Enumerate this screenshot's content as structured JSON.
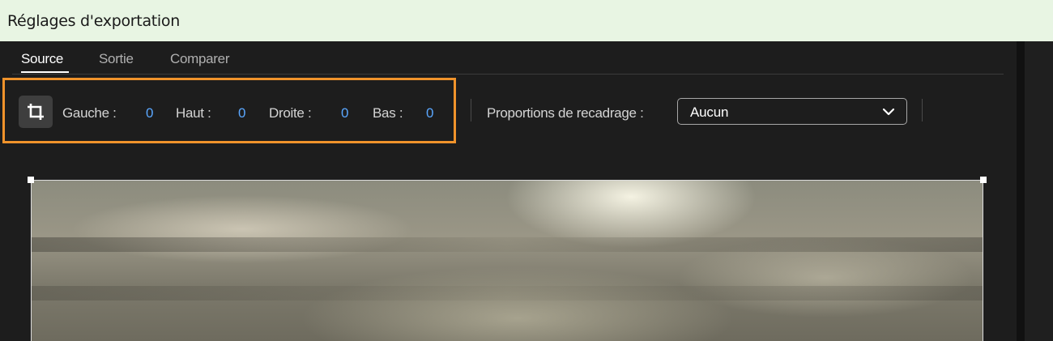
{
  "window": {
    "title": "Réglages d'exportation"
  },
  "tabs": [
    {
      "label": "Source",
      "active": true
    },
    {
      "label": "Sortie",
      "active": false
    },
    {
      "label": "Comparer",
      "active": false
    }
  ],
  "crop": {
    "tool_icon": "crop-icon",
    "left_label": "Gauche :",
    "left_value": "0",
    "top_label": "Haut :",
    "top_value": "0",
    "right_label": "Droite :",
    "right_value": "0",
    "bottom_label": "Bas :",
    "bottom_value": "0",
    "ratio_label": "Proportions de recadrage :",
    "ratio_value": "Aucun",
    "highlight_color": "#f0932b"
  },
  "colors": {
    "value_blue": "#5aa7ff",
    "title_bar": "#e8f5e3",
    "panel_bg": "#1d1d1d"
  }
}
